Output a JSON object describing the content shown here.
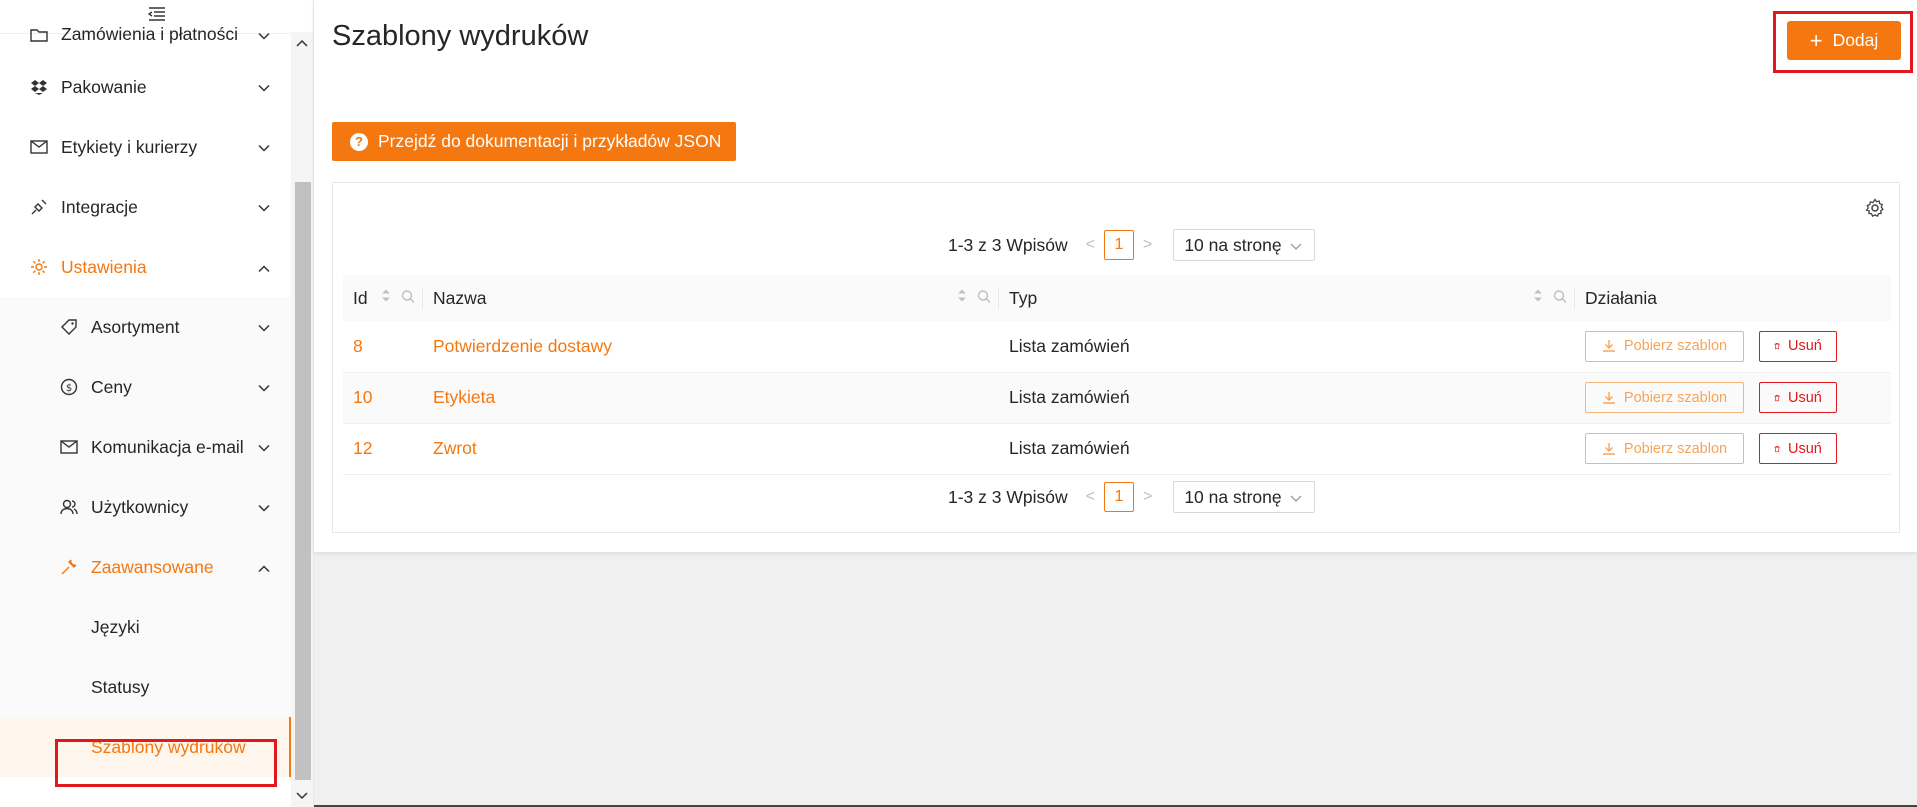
{
  "sidebar": {
    "items": [
      {
        "label": "Zamówienia i płatności",
        "icon": "folder-icon",
        "expanded": false
      },
      {
        "label": "Pakowanie",
        "icon": "dropbox-icon",
        "expanded": false
      },
      {
        "label": "Etykiety i kurierzy",
        "icon": "mail-icon",
        "expanded": false
      },
      {
        "label": "Integracje",
        "icon": "api-icon",
        "expanded": false
      },
      {
        "label": "Ustawienia",
        "icon": "settings-icon",
        "expanded": true,
        "active": true
      }
    ],
    "settings_children": [
      {
        "label": "Asortyment",
        "icon": "tag-icon"
      },
      {
        "label": "Ceny",
        "icon": "dollar-icon"
      },
      {
        "label": "Komunikacja e-mail",
        "icon": "mail-icon"
      },
      {
        "label": "Użytkownicy",
        "icon": "users-icon"
      },
      {
        "label": "Zaawansowane",
        "icon": "tool-icon",
        "active": true
      }
    ],
    "advanced_children": [
      {
        "label": "Języki"
      },
      {
        "label": "Statusy"
      },
      {
        "label": "Szablony wydruków",
        "selected": true
      }
    ]
  },
  "main": {
    "title": "Szablony wydruków",
    "add_label": "Dodaj",
    "docs_label": "Przejdź do dokumentacji i przykładów JSON"
  },
  "pagination": {
    "summary": "1-3 z 3 Wpisów",
    "current_page": "1",
    "page_size": "10 na stronę"
  },
  "table": {
    "columns": [
      "Id",
      "Nazwa",
      "Typ",
      "Działania"
    ],
    "rows": [
      {
        "id": "8",
        "name": "Potwierdzenie dostawy",
        "type": "Lista zamówień"
      },
      {
        "id": "10",
        "name": "Etykieta",
        "type": "Lista zamówień"
      },
      {
        "id": "12",
        "name": "Zwrot",
        "type": "Lista zamówień"
      }
    ],
    "download_label": "Pobierz szablon",
    "delete_label": "Usuń"
  },
  "colors": {
    "accent": "#f5770f",
    "danger": "#e2191c",
    "highlight": "#e2191c"
  }
}
